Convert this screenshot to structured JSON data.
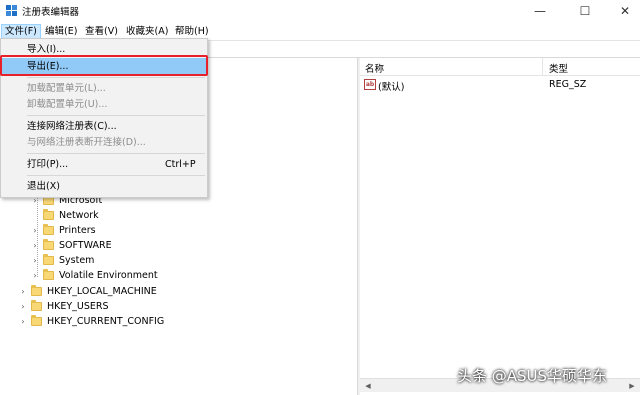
{
  "window": {
    "title": "注册表编辑器",
    "controls": {
      "minimize": "—",
      "maximize": "☐",
      "close": "✕"
    }
  },
  "menubar": {
    "items": [
      "文件(F)",
      "编辑(E)",
      "查看(V)",
      "收藏夹(A)",
      "帮助(H)"
    ],
    "active_index": 0
  },
  "file_menu": {
    "items": [
      {
        "label": "导入(I)...",
        "enabled": true
      },
      {
        "label": "导出(E)...",
        "enabled": true,
        "highlighted": true
      },
      {
        "label": "加载配置单元(L)...",
        "enabled": false
      },
      {
        "label": "卸载配置单元(U)...",
        "enabled": false
      },
      {
        "label": "连接网络注册表(C)...",
        "enabled": true
      },
      {
        "label": "与网络注册表断开连接(D)...",
        "enabled": false
      },
      {
        "label": "打印(P)...",
        "enabled": true,
        "shortcut": "Ctrl+P"
      },
      {
        "label": "退出(X)",
        "enabled": true
      }
    ]
  },
  "tree": {
    "children": [
      "Microsoft",
      "Network",
      "Printers",
      "SOFTWARE",
      "System",
      "Volatile Environment"
    ],
    "roots": [
      "HKEY_LOCAL_MACHINE",
      "HKEY_USERS",
      "HKEY_CURRENT_CONFIG"
    ]
  },
  "list": {
    "columns": {
      "name": "名称",
      "type": "类型"
    },
    "rows": [
      {
        "name": "(默认)",
        "type": "REG_SZ",
        "icon": "ab-string-icon"
      }
    ]
  },
  "watermark": "头条 @ASUS华硕华东",
  "colors": {
    "highlight_border": "#e8202a",
    "menu_hover": "#91c9f7",
    "folder": "#f8d775"
  }
}
